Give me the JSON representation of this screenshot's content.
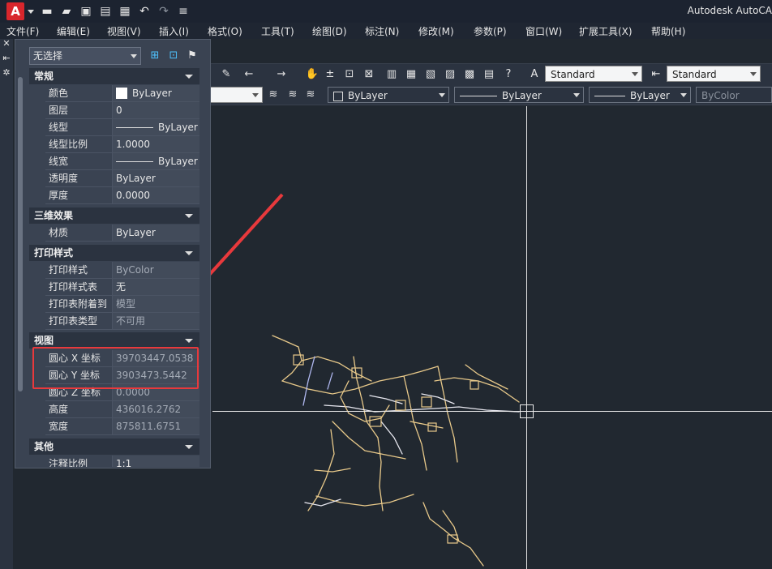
{
  "titlebar": {
    "logo_letter": "A",
    "app_title": "Autodesk AutoCA"
  },
  "menubar": {
    "items": [
      "文件(F)",
      "编辑(E)",
      "视图(V)",
      "插入(I)",
      "格式(O)",
      "工具(T)",
      "绘图(D)",
      "标注(N)",
      "修改(M)",
      "参数(P)",
      "窗口(W)",
      "扩展工具(X)",
      "帮助(H)"
    ]
  },
  "toolbar": {
    "text_style": "Standard",
    "dim_style": "Standard",
    "color": "ByLayer",
    "linetype": "ByLayer",
    "lineweight": "ByLayer",
    "plotstyle": "ByColor"
  },
  "properties": {
    "selection": "无选择",
    "sections": {
      "general": "常规",
      "threed": "三维效果",
      "plot": "打印样式",
      "view": "视图",
      "misc": "其他"
    },
    "general": [
      {
        "k": "颜色",
        "v": "ByLayer"
      },
      {
        "k": "图层",
        "v": "0"
      },
      {
        "k": "线型",
        "v": "ByLayer"
      },
      {
        "k": "线型比例",
        "v": "1.0000"
      },
      {
        "k": "线宽",
        "v": "ByLayer"
      },
      {
        "k": "透明度",
        "v": "ByLayer"
      },
      {
        "k": "厚度",
        "v": "0.0000"
      }
    ],
    "threed": [
      {
        "k": "材质",
        "v": "ByLayer"
      }
    ],
    "plot": [
      {
        "k": "打印样式",
        "v": "ByColor"
      },
      {
        "k": "打印样式表",
        "v": "无"
      },
      {
        "k": "打印表附着到",
        "v": "模型"
      },
      {
        "k": "打印表类型",
        "v": "不可用"
      }
    ],
    "view": [
      {
        "k": "圆心 X 坐标",
        "v": "39703447.0538"
      },
      {
        "k": "圆心 Y 坐标",
        "v": "3903473.5442"
      },
      {
        "k": "圆心 Z 坐标",
        "v": "0.0000"
      },
      {
        "k": "高度",
        "v": "436016.2762"
      },
      {
        "k": "宽度",
        "v": "875811.6751"
      }
    ],
    "misc": [
      {
        "k": "注释比例",
        "v": "1:1"
      }
    ]
  },
  "colors": {
    "accent_red": "#e8393c",
    "road_yellow": "#e8c98a",
    "road_white": "#e8e8f0"
  }
}
